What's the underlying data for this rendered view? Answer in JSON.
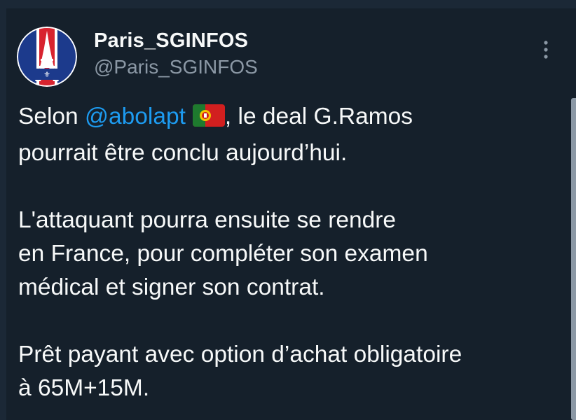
{
  "author": {
    "display_name": "Paris_SGINFOS",
    "handle": "@Paris_SGINFOS",
    "avatar_icon": "psg-crest-icon"
  },
  "more_icon": "more-vertical-icon",
  "tweet": {
    "p1_before": "Selon ",
    "mention": "@abolapt",
    "flag_icon": "portugal-flag-icon",
    "p1_after_line1": ", le deal G.Ramos",
    "p1_line2": "pourrait être conclu aujourd’hui.",
    "p2_line1": "L'attaquant pourra ensuite se rendre",
    "p2_line2": "en France, pour compléter son examen",
    "p2_line3": "médical et signer son contrat.",
    "p3_line1": "Prêt payant avec option d’achat obligatoire",
    "p3_line2": "à 65M+15M."
  },
  "colors": {
    "background": "#15202b",
    "text": "#f7f9f9",
    "secondary_text": "#8b98a5",
    "link": "#1d9bf0"
  }
}
